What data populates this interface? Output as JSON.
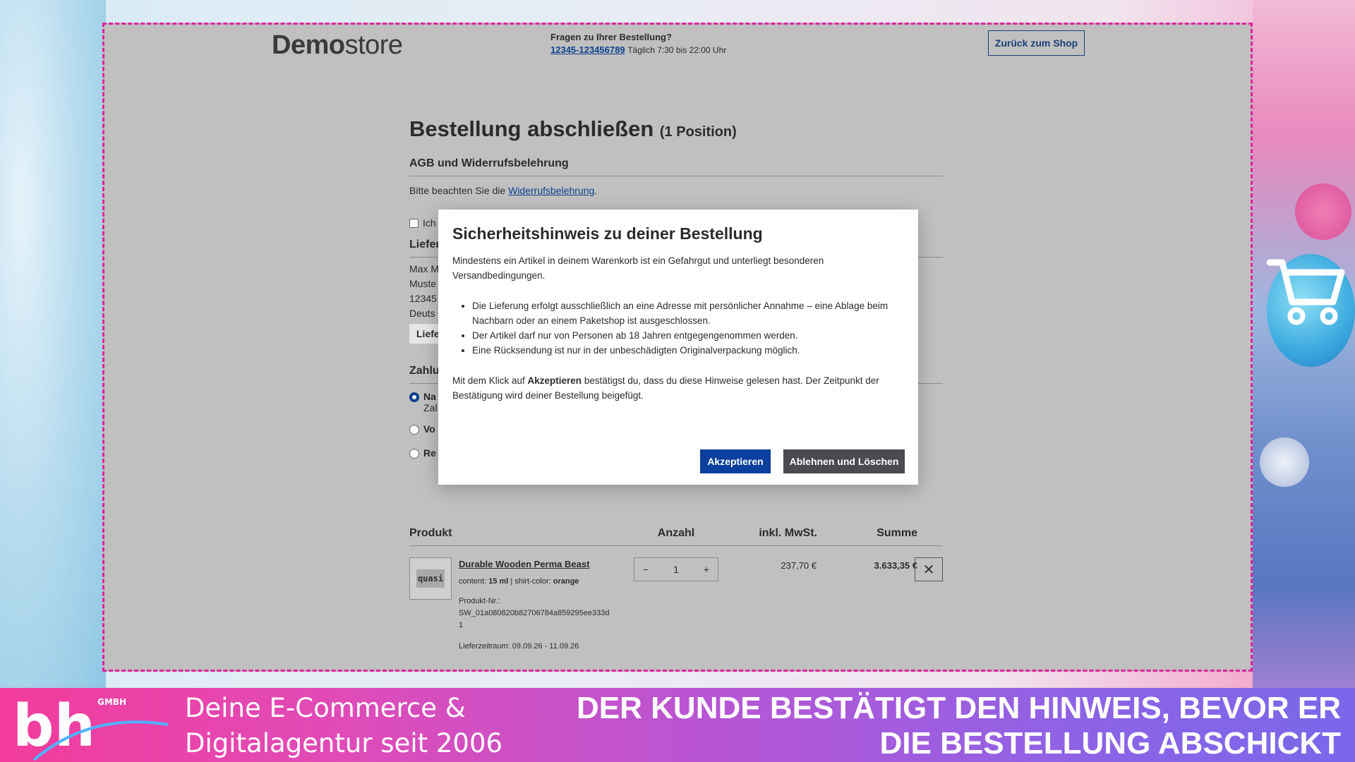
{
  "header": {
    "logo_bold": "Demo",
    "logo_light": "store",
    "help_question": "Fragen zu Ihrer Bestellung?",
    "help_phone": "12345-123456789",
    "help_hours": "Täglich 7:30 bis 22:00 Uhr",
    "back_button": "Zurück zum Shop"
  },
  "page": {
    "title": "Bestellung abschließen",
    "position_count": "(1 Position)",
    "agb_title": "AGB und Widerrufsbelehrung",
    "agb_text_prefix": "Bitte beachten Sie die ",
    "agb_link": "Widerrufsbelehrung",
    "agb_text_suffix": ".",
    "checkbox_partial": "Ich",
    "delivery_partial_title": "Liefer",
    "address_lines": [
      "Max M",
      "Muste",
      "12345",
      "Deuts"
    ],
    "delivery_partial_button": "Liefe",
    "payment_partial_title": "Zahlu",
    "payment_options": [
      {
        "label": "Na",
        "sub": "Zal",
        "selected": true
      },
      {
        "label": "Vo",
        "sub": "",
        "selected": false
      },
      {
        "label": "Re",
        "sub": "",
        "selected": false
      }
    ]
  },
  "table": {
    "headers": {
      "product": "Produkt",
      "qty": "Anzahl",
      "tax": "inkl. MwSt.",
      "sum": "Summe"
    },
    "row": {
      "thumb_text": "quasi",
      "name": "Durable Wooden Perma Beast",
      "content_label": "content: ",
      "content_value": "15 ml",
      "sep": " | ",
      "color_label": "shirt-color: ",
      "color_value": "orange",
      "nr_label": "Produkt-Nr.:",
      "nr_value": "SW_01a080820b82706784a859295ee333d1",
      "delivery": "Lieferzeitraum: 09.09.26 - 11.09.26",
      "qty_minus": "−",
      "qty_value": "1",
      "qty_plus": "+",
      "price": "237,70 €",
      "total": "3.633,35 €",
      "remove": "✕"
    }
  },
  "modal": {
    "title": "Sicherheitshinweis zu deiner Bestellung",
    "intro": "Mindestens ein Artikel in deinem Warenkorb ist ein Gefahrgut und unterliegt besonderen Versandbedingungen.",
    "bullets": [
      "Die Lieferung erfolgt ausschließlich an eine Adresse mit persönlicher Annahme – eine Ablage beim Nachbarn oder an einem Paketshop ist ausgeschlossen.",
      "Der Artikel darf nur von Personen ab 18 Jahren entgegengenommen werden.",
      "Eine Rücksendung ist nur in der unbeschädigten Originalverpackung möglich."
    ],
    "confirm_prefix": "Mit dem Klick auf ",
    "confirm_bold": "Akzeptieren",
    "confirm_suffix": " bestätigst du, dass du diese Hinweise gelesen hast. Der Zeitpunkt der Bestätigung wird deiner Bestellung beigefügt.",
    "accept": "Akzeptieren",
    "decline": "Ablehnen und Löschen"
  },
  "banner": {
    "logo_text": "bh",
    "logo_gmbh": "GMBH",
    "tagline_1": "Deine E-Commerce &",
    "tagline_2": "Digitalagentur seit 2006",
    "headline_1": "DER KUNDE BESTÄTIGT DEN HINWEIS, BEVOR ER",
    "headline_2": "DIE BESTELLUNG ABSCHICKT"
  },
  "colors": {
    "accent": "#0b3f9e",
    "frame": "#e0239c",
    "decline": "#4a4a4f"
  }
}
